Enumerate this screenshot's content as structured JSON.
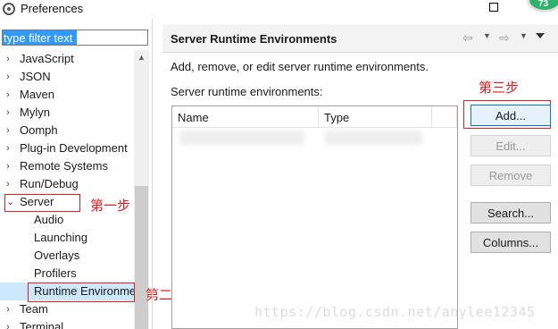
{
  "window": {
    "title": "Preferences",
    "badge_text": "73"
  },
  "filter": {
    "value": "type filter text"
  },
  "tree": [
    {
      "label": "JavaScript",
      "arrow": "›"
    },
    {
      "label": "JSON",
      "arrow": "›"
    },
    {
      "label": "Maven",
      "arrow": "›"
    },
    {
      "label": "Mylyn",
      "arrow": "›"
    },
    {
      "label": "Oomph",
      "arrow": "›"
    },
    {
      "label": "Plug-in Development",
      "arrow": "›"
    },
    {
      "label": "Remote Systems",
      "arrow": "›"
    },
    {
      "label": "Run/Debug",
      "arrow": "›"
    },
    {
      "label": "Server",
      "arrow": "⌄"
    },
    {
      "label": "Audio"
    },
    {
      "label": "Launching"
    },
    {
      "label": "Overlays"
    },
    {
      "label": "Profilers"
    },
    {
      "label": "Runtime Environme"
    },
    {
      "label": "Team",
      "arrow": "›"
    },
    {
      "label": "Terminal",
      "arrow": "›"
    }
  ],
  "annotations": {
    "step1": "第一步",
    "step2": "第二步",
    "step3": "第三步"
  },
  "page": {
    "title": "Server Runtime Environments",
    "description": "Add, remove, or edit server runtime environments.",
    "table_label": "Server runtime environments:",
    "columns": [
      "Name",
      "Type"
    ]
  },
  "buttons": {
    "add": "Add...",
    "edit": "Edit...",
    "remove": "Remove",
    "search": "Search...",
    "columns": "Columns..."
  },
  "watermark": "https://blog.csdn.net/anylee12345"
}
